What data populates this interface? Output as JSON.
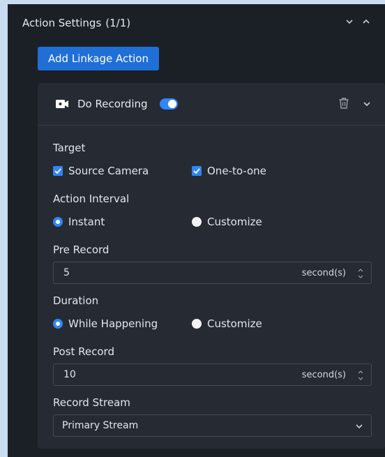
{
  "header": {
    "title": "Action Settings",
    "count": "(1/1)"
  },
  "add_button": {
    "label": "Add Linkage Action"
  },
  "action_card": {
    "title": "Do Recording",
    "enabled": true,
    "icons": [
      "camera-icon",
      "trash-icon",
      "chevron-down-icon"
    ]
  },
  "target": {
    "label": "Target",
    "options": [
      {
        "label": "Source Camera",
        "checked": true
      },
      {
        "label": "One-to-one",
        "checked": true
      }
    ]
  },
  "action_interval": {
    "label": "Action Interval",
    "options": [
      {
        "label": "Instant",
        "selected": true
      },
      {
        "label": "Customize",
        "selected": false
      }
    ]
  },
  "pre_record": {
    "label": "Pre Record",
    "value": "5",
    "unit": "second(s)"
  },
  "duration": {
    "label": "Duration",
    "options": [
      {
        "label": "While Happening",
        "selected": true
      },
      {
        "label": "Customize",
        "selected": false
      }
    ]
  },
  "post_record": {
    "label": "Post Record",
    "value": "10",
    "unit": "second(s)"
  },
  "record_stream": {
    "label": "Record Stream",
    "value": "Primary Stream"
  },
  "colors": {
    "accent": "#2f86f6",
    "button": "#1f6fd6",
    "panel": "#1b1f26",
    "card": "#262b33"
  }
}
